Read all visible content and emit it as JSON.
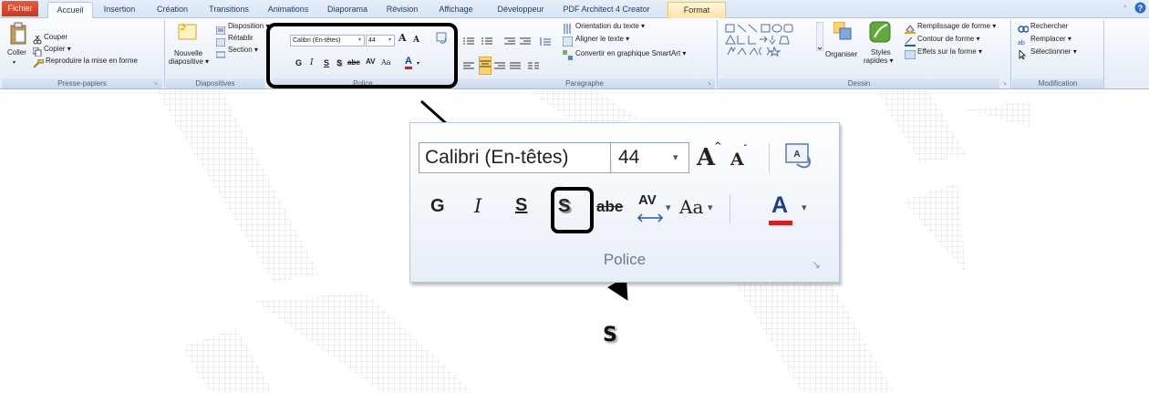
{
  "tabs": {
    "file": "Fichier",
    "items": [
      "Accueil",
      "Insertion",
      "Création",
      "Transitions",
      "Animations",
      "Diaporama",
      "Révision",
      "Affichage",
      "Développeur",
      "PDF Architect 4 Creator",
      "Format"
    ],
    "active": "Accueil",
    "contextual": "Format"
  },
  "ribbon": {
    "clipboard": {
      "paste": "Coller",
      "cut": "Couper",
      "copy": "Copier ▾",
      "format_painter": "Reproduire la mise en forme",
      "label": "Presse-papiers"
    },
    "slides": {
      "new_slide_1": "Nouvelle",
      "new_slide_2": "diapositive ▾",
      "layout": "Disposition ▾",
      "reset": "Rétablir",
      "section": "Section ▾",
      "label": "Diapositives"
    },
    "font": {
      "font_name": "Calibri (En-têtes)",
      "font_size": "44",
      "grow": "A",
      "shrink": "A",
      "clear": "A",
      "bold": "G",
      "italic": "I",
      "underline": "S",
      "shadow": "S",
      "strike": "abe",
      "spacing": "AV",
      "case": "Aa",
      "color": "A",
      "label": "Police"
    },
    "paragraph": {
      "text_direction": "Orientation du texte ▾",
      "align_text": "Aligner le texte ▾",
      "smartart": "Convertir en graphique SmartArt ▾",
      "label": "Paragraphe"
    },
    "drawing": {
      "arrange": "Organiser",
      "styles_1": "Styles",
      "styles_2": "rapides ▾",
      "fill": "Remplissage de forme ▾",
      "outline": "Contour de forme ▾",
      "effects": "Effets sur la forme ▾",
      "label": "Dessin"
    },
    "editing": {
      "find": "Rechercher",
      "replace": "Remplacer ▾",
      "select": "Sélectionner ▾",
      "label": "Modification"
    }
  },
  "zoom": {
    "font_name": "Calibri (En-têtes)",
    "font_size": "44",
    "bold": "G",
    "italic": "I",
    "underline": "S",
    "shadow": "S",
    "strike": "abe",
    "spacing": "AV",
    "case": "Aa",
    "color": "A",
    "label": "Police",
    "grow": "A",
    "shrink": "A"
  },
  "callout": {
    "symbol": "S"
  },
  "colors": {
    "accent": "#1f3d66",
    "file_tab": "#d94a2c",
    "font_color_bar": "#e01a1a",
    "frame": "#000000"
  }
}
